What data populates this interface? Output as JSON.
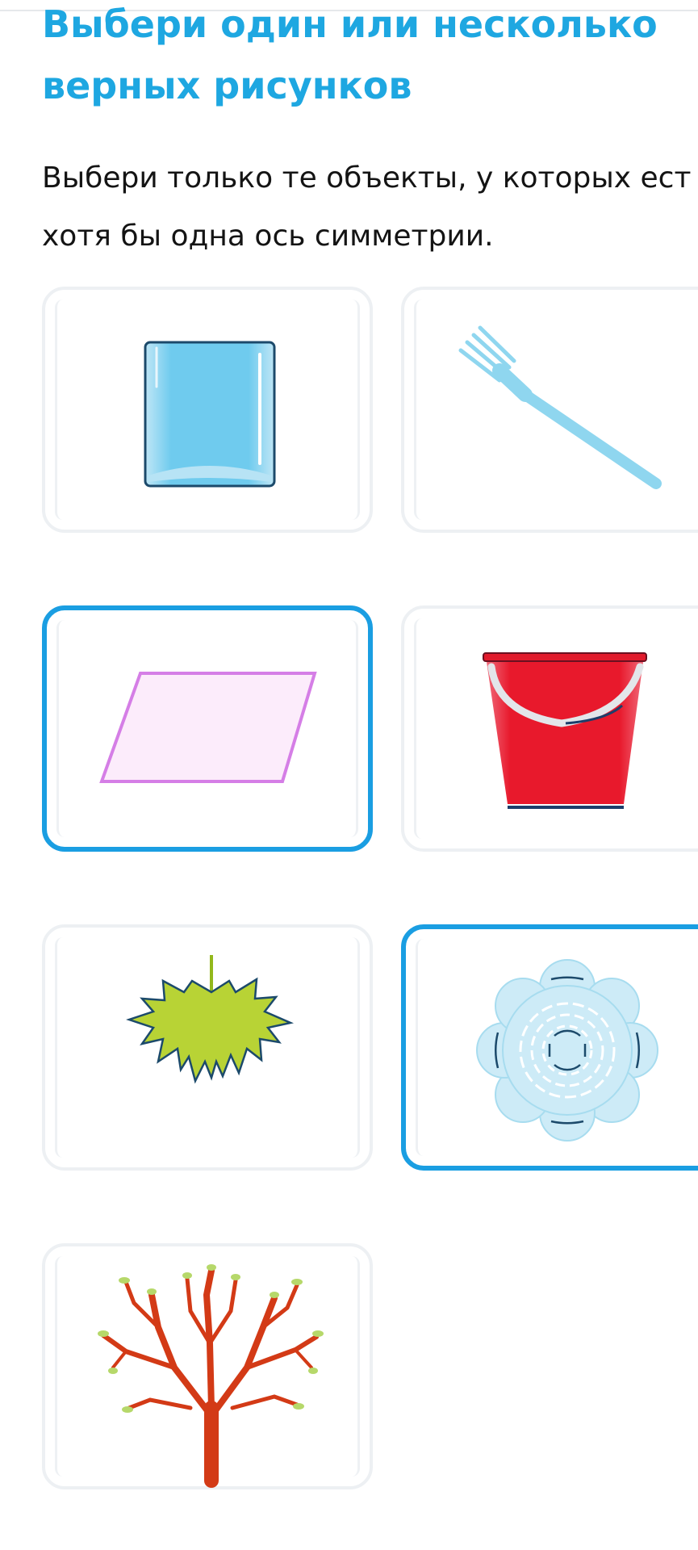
{
  "task": {
    "title_line1": "Выбери один или несколько",
    "title_line2": "верных рисунков",
    "instruction_line1": "Выбери только те объекты, у которых ест",
    "instruction_line2": "хотя бы одна ось симметрии."
  },
  "colors": {
    "accent": "#1ea7e1",
    "selected_border": "#1a9ee2",
    "card_border": "#edf0f3"
  },
  "options": [
    {
      "icon": "glass-of-water-icon",
      "selected": false
    },
    {
      "icon": "fork-icon",
      "selected": false
    },
    {
      "icon": "parallelogram-icon",
      "selected": true
    },
    {
      "icon": "bucket-icon",
      "selected": false
    },
    {
      "icon": "maple-leaf-icon",
      "selected": false
    },
    {
      "icon": "round-dish-icon",
      "selected": true
    },
    {
      "icon": "tree-icon",
      "selected": false
    }
  ]
}
